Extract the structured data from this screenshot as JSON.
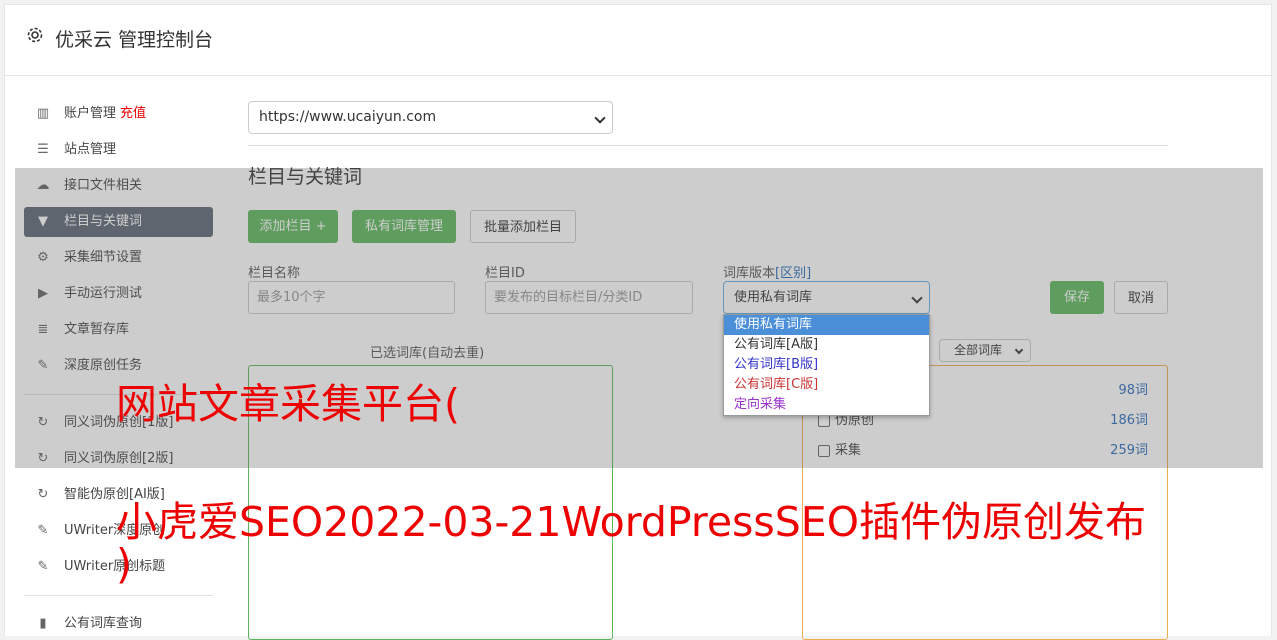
{
  "header": {
    "title": "优采云 管理控制台",
    "icon": "gear-icon"
  },
  "sidebar": {
    "items": [
      {
        "label": "账户管理",
        "extra": "充值",
        "icon": "bar-chart-icon"
      },
      {
        "label": "站点管理",
        "icon": "server-icon"
      },
      {
        "label": "接口文件相关",
        "icon": "cloud-upload-icon"
      },
      {
        "label": "栏目与关键词",
        "icon": "filter-icon",
        "active": true
      },
      {
        "label": "采集细节设置",
        "icon": "cogs-icon"
      },
      {
        "label": "手动运行测试",
        "icon": "play-circle-icon"
      },
      {
        "label": "文章暂存库",
        "icon": "database-icon"
      },
      {
        "label": "深度原创任务",
        "icon": "edit-icon"
      },
      {
        "label": "同义词伪原创[1版]",
        "icon": "refresh-icon"
      },
      {
        "label": "同义词伪原创[2版]",
        "icon": "refresh-icon"
      },
      {
        "label": "智能伪原创[AI版]",
        "icon": "refresh-icon"
      },
      {
        "label": "UWriter深度原创",
        "icon": "edit-icon"
      },
      {
        "label": "UWriter原创标题",
        "icon": "edit-icon"
      },
      {
        "label": "公有词库查询",
        "icon": "book-icon"
      }
    ]
  },
  "main": {
    "site_select": "https://www.ucaiyun.com",
    "section_title": "栏目与关键词",
    "buttons": {
      "add_column": "添加栏目 +",
      "private_lib": "私有词库管理",
      "batch_add": "批量添加栏目"
    },
    "form": {
      "name_label": "栏目名称",
      "name_placeholder": "最多10个字",
      "id_label": "栏目ID",
      "id_placeholder": "要发布的目标栏目/分类ID",
      "version_label": "词库版本",
      "version_link": "[区别]",
      "version_value": "使用私有词库",
      "save": "保存",
      "cancel": "取消"
    },
    "version_options": [
      {
        "label": "使用私有词库",
        "color": "#ffffff",
        "selected": true
      },
      {
        "label": "公有词库[A版]",
        "color": "#333333"
      },
      {
        "label": "公有词库[B版]",
        "color": "#3333cc"
      },
      {
        "label": "公有词库[C版]",
        "color": "#cc3333"
      },
      {
        "label": "定向采集",
        "color": "#9933cc"
      }
    ],
    "selected_lib_label": "已选词库(自动去重)",
    "all_lib_select": "全部词库",
    "libs": [
      {
        "name": "",
        "count": "98词"
      },
      {
        "name": "伪原创",
        "count": "186词"
      },
      {
        "name": "采集",
        "count": "259词"
      }
    ]
  },
  "watermark": {
    "line1": "网站文章采集平台(",
    "line2": "小虎爱SEO2022-03-21WordPressSEO插件伪原创发布",
    "line3": ")"
  }
}
